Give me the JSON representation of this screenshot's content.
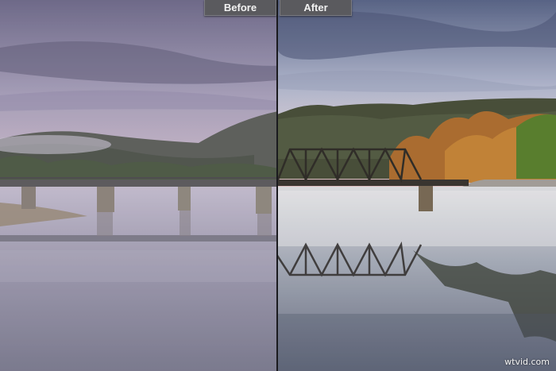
{
  "labels": {
    "before": "Before",
    "after": "After"
  },
  "watermark": "wtvid.com",
  "colors": {
    "label_background": "#5a5a5e",
    "divider": "#1b1b1f",
    "label_text": "#f2f2f2"
  }
}
